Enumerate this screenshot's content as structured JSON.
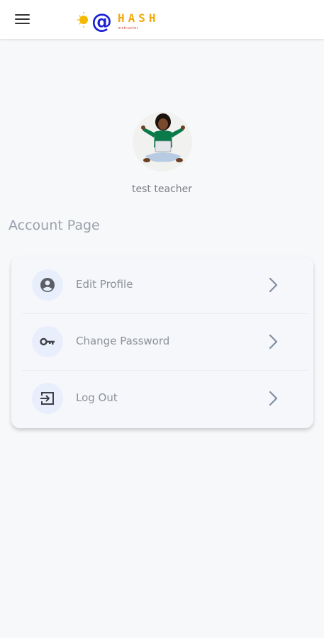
{
  "app_bar": {
    "menu_icon": "hamburger-menu-icon",
    "logo": {
      "at_symbol": "@",
      "text": "HASH",
      "subtext": "instructor",
      "colors": {
        "sun": "#f5b800",
        "at": "#1a1fd6",
        "text": "#f2a90c",
        "sub": "#d23a2a"
      }
    }
  },
  "profile": {
    "name": "test teacher",
    "avatar_icon": "user-photo-avatar"
  },
  "page": {
    "title": "Account Page"
  },
  "menu": {
    "items": [
      {
        "label": "Edit Profile",
        "icon": "account-circle-icon"
      },
      {
        "label": "Change Password",
        "icon": "key-icon"
      },
      {
        "label": "Log Out",
        "icon": "logout-icon"
      }
    ],
    "chevron_icon": "chevron-right-icon"
  },
  "colors": {
    "background": "#f7f8fa",
    "card": "#f5f7fa",
    "icon_circle": "#e8eefc",
    "text_muted": "#8d9199",
    "chevron": "#7f8fa3"
  }
}
